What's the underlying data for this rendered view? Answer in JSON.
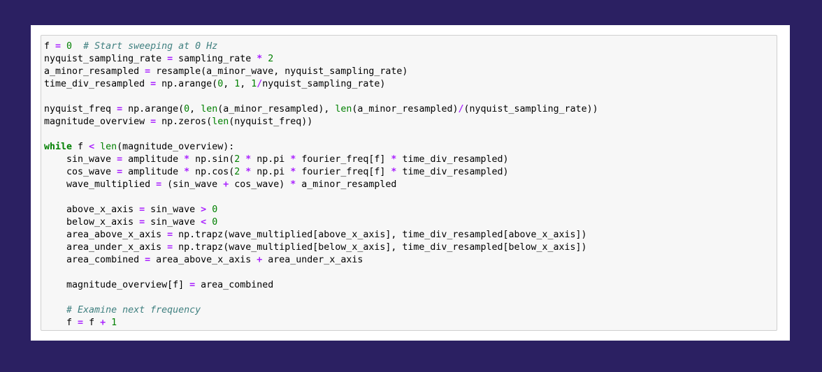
{
  "colors": {
    "background": "#2b2062",
    "frame": "#ffffff",
    "cell_background": "#f7f7f7",
    "cell_border": "#cfcfcf",
    "operator": "#aa22ff",
    "number": "#008000",
    "keyword": "#008000",
    "builtin": "#008000",
    "comment": "#408080",
    "text": "#000000"
  },
  "code_cell": {
    "lines": [
      [
        {
          "t": "id",
          "v": "f "
        },
        {
          "t": "op",
          "v": "="
        },
        {
          "t": "id",
          "v": " "
        },
        {
          "t": "num",
          "v": "0"
        },
        {
          "t": "id",
          "v": "  "
        },
        {
          "t": "cm",
          "v": "# Start sweeping at 0 Hz"
        }
      ],
      [
        {
          "t": "id",
          "v": "nyquist_sampling_rate "
        },
        {
          "t": "op",
          "v": "="
        },
        {
          "t": "id",
          "v": " sampling_rate "
        },
        {
          "t": "op",
          "v": "*"
        },
        {
          "t": "id",
          "v": " "
        },
        {
          "t": "num",
          "v": "2"
        }
      ],
      [
        {
          "t": "id",
          "v": "a_minor_resampled "
        },
        {
          "t": "op",
          "v": "="
        },
        {
          "t": "id",
          "v": " resample(a_minor_wave, nyquist_sampling_rate)"
        }
      ],
      [
        {
          "t": "id",
          "v": "time_div_resampled "
        },
        {
          "t": "op",
          "v": "="
        },
        {
          "t": "id",
          "v": " np.arange("
        },
        {
          "t": "num",
          "v": "0"
        },
        {
          "t": "id",
          "v": ", "
        },
        {
          "t": "num",
          "v": "1"
        },
        {
          "t": "id",
          "v": ", "
        },
        {
          "t": "num",
          "v": "1"
        },
        {
          "t": "op",
          "v": "/"
        },
        {
          "t": "id",
          "v": "nyquist_sampling_rate)"
        }
      ],
      [],
      [
        {
          "t": "id",
          "v": "nyquist_freq "
        },
        {
          "t": "op",
          "v": "="
        },
        {
          "t": "id",
          "v": " np.arange("
        },
        {
          "t": "num",
          "v": "0"
        },
        {
          "t": "id",
          "v": ", "
        },
        {
          "t": "bi",
          "v": "len"
        },
        {
          "t": "id",
          "v": "(a_minor_resampled), "
        },
        {
          "t": "bi",
          "v": "len"
        },
        {
          "t": "id",
          "v": "(a_minor_resampled)"
        },
        {
          "t": "op",
          "v": "/"
        },
        {
          "t": "id",
          "v": "(nyquist_sampling_rate))"
        }
      ],
      [
        {
          "t": "id",
          "v": "magnitude_overview "
        },
        {
          "t": "op",
          "v": "="
        },
        {
          "t": "id",
          "v": " np.zeros("
        },
        {
          "t": "bi",
          "v": "len"
        },
        {
          "t": "id",
          "v": "(nyquist_freq))"
        }
      ],
      [],
      [
        {
          "t": "kw",
          "v": "while"
        },
        {
          "t": "id",
          "v": " f "
        },
        {
          "t": "op",
          "v": "<"
        },
        {
          "t": "id",
          "v": " "
        },
        {
          "t": "bi",
          "v": "len"
        },
        {
          "t": "id",
          "v": "(magnitude_overview):"
        }
      ],
      [
        {
          "t": "id",
          "v": "    sin_wave "
        },
        {
          "t": "op",
          "v": "="
        },
        {
          "t": "id",
          "v": " amplitude "
        },
        {
          "t": "op",
          "v": "*"
        },
        {
          "t": "id",
          "v": " np.sin("
        },
        {
          "t": "num",
          "v": "2"
        },
        {
          "t": "id",
          "v": " "
        },
        {
          "t": "op",
          "v": "*"
        },
        {
          "t": "id",
          "v": " np.pi "
        },
        {
          "t": "op",
          "v": "*"
        },
        {
          "t": "id",
          "v": " fourier_freq[f] "
        },
        {
          "t": "op",
          "v": "*"
        },
        {
          "t": "id",
          "v": " time_div_resampled)"
        }
      ],
      [
        {
          "t": "id",
          "v": "    cos_wave "
        },
        {
          "t": "op",
          "v": "="
        },
        {
          "t": "id",
          "v": " amplitude "
        },
        {
          "t": "op",
          "v": "*"
        },
        {
          "t": "id",
          "v": " np.cos("
        },
        {
          "t": "num",
          "v": "2"
        },
        {
          "t": "id",
          "v": " "
        },
        {
          "t": "op",
          "v": "*"
        },
        {
          "t": "id",
          "v": " np.pi "
        },
        {
          "t": "op",
          "v": "*"
        },
        {
          "t": "id",
          "v": " fourier_freq[f] "
        },
        {
          "t": "op",
          "v": "*"
        },
        {
          "t": "id",
          "v": " time_div_resampled)"
        }
      ],
      [
        {
          "t": "id",
          "v": "    wave_multiplied "
        },
        {
          "t": "op",
          "v": "="
        },
        {
          "t": "id",
          "v": " (sin_wave "
        },
        {
          "t": "op",
          "v": "+"
        },
        {
          "t": "id",
          "v": " cos_wave) "
        },
        {
          "t": "op",
          "v": "*"
        },
        {
          "t": "id",
          "v": " a_minor_resampled"
        }
      ],
      [],
      [
        {
          "t": "id",
          "v": "    above_x_axis "
        },
        {
          "t": "op",
          "v": "="
        },
        {
          "t": "id",
          "v": " sin_wave "
        },
        {
          "t": "op",
          "v": ">"
        },
        {
          "t": "id",
          "v": " "
        },
        {
          "t": "num",
          "v": "0"
        }
      ],
      [
        {
          "t": "id",
          "v": "    below_x_axis "
        },
        {
          "t": "op",
          "v": "="
        },
        {
          "t": "id",
          "v": " sin_wave "
        },
        {
          "t": "op",
          "v": "<"
        },
        {
          "t": "id",
          "v": " "
        },
        {
          "t": "num",
          "v": "0"
        }
      ],
      [
        {
          "t": "id",
          "v": "    area_above_x_axis "
        },
        {
          "t": "op",
          "v": "="
        },
        {
          "t": "id",
          "v": " np.trapz(wave_multiplied[above_x_axis], time_div_resampled[above_x_axis])"
        }
      ],
      [
        {
          "t": "id",
          "v": "    area_under_x_axis "
        },
        {
          "t": "op",
          "v": "="
        },
        {
          "t": "id",
          "v": " np.trapz(wave_multiplied[below_x_axis], time_div_resampled[below_x_axis])"
        }
      ],
      [
        {
          "t": "id",
          "v": "    area_combined "
        },
        {
          "t": "op",
          "v": "="
        },
        {
          "t": "id",
          "v": " area_above_x_axis "
        },
        {
          "t": "op",
          "v": "+"
        },
        {
          "t": "id",
          "v": " area_under_x_axis"
        }
      ],
      [],
      [
        {
          "t": "id",
          "v": "    magnitude_overview[f] "
        },
        {
          "t": "op",
          "v": "="
        },
        {
          "t": "id",
          "v": " area_combined"
        }
      ],
      [],
      [
        {
          "t": "id",
          "v": "    "
        },
        {
          "t": "cm",
          "v": "# Examine next frequency"
        }
      ],
      [
        {
          "t": "id",
          "v": "    f "
        },
        {
          "t": "op",
          "v": "="
        },
        {
          "t": "id",
          "v": " f "
        },
        {
          "t": "op",
          "v": "+"
        },
        {
          "t": "id",
          "v": " "
        },
        {
          "t": "num",
          "v": "1"
        }
      ]
    ]
  }
}
